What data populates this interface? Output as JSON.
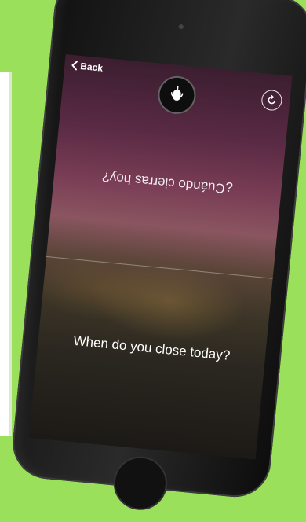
{
  "nav": {
    "back_label": "Back"
  },
  "translation": {
    "spanish": "¿Cuándo cierras hoy?",
    "english": "When do you close today?"
  },
  "icons": {
    "back": "chevron-left-icon",
    "mic": "microphone-icon",
    "refresh": "refresh-icon"
  },
  "colors": {
    "background": "#9be05a",
    "text": "#ffffff"
  }
}
